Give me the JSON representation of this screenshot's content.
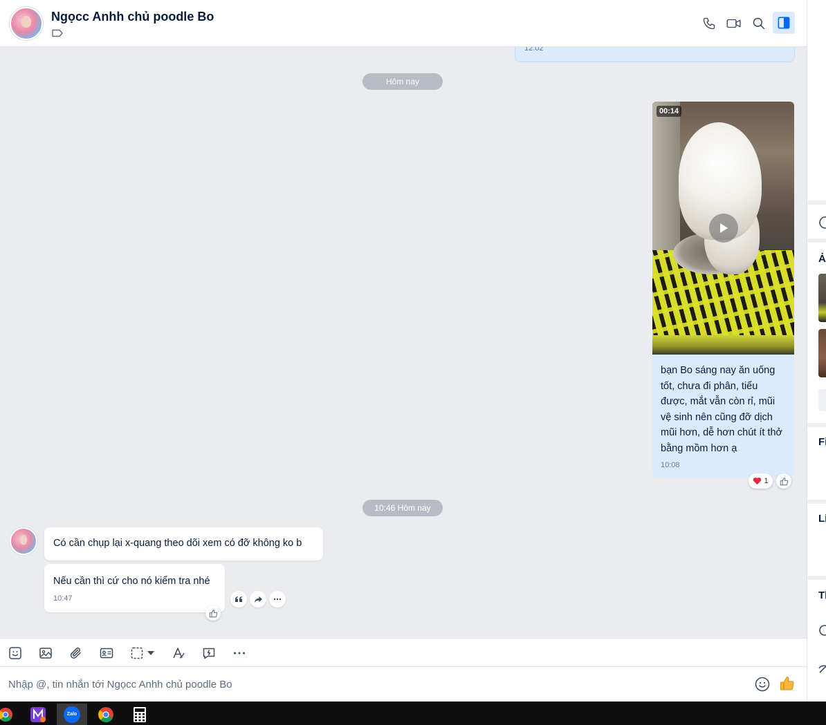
{
  "header": {
    "contact_name": "Ngọcc Anhh chủ poodle Bo",
    "icons": [
      "phone-icon",
      "video-call-icon",
      "search-icon",
      "sidebar-toggle-icon"
    ]
  },
  "chat": {
    "previous_time": "12:02",
    "date_separator_1": "Hôm nay",
    "video": {
      "duration": "00:14",
      "caption": "bạn Bo sáng nay ăn uống tốt, chưa đi phân, tiểu được, mắt vẫn còn rỉ, mũi vệ sinh nên cũng đỡ dịch mũi hơn, dễ hơn chút ít thở bằng mồm hơn ạ",
      "time": "10:08",
      "reaction_count": "1"
    },
    "date_separator_2": "10:46 Hôm nay",
    "incoming": [
      {
        "text": "Có cần chụp lại x-quang theo dõi xem có đỡ không ko b"
      },
      {
        "text": "Nếu cần thì cứ cho nó kiểm tra nhé",
        "time": "10:47"
      }
    ]
  },
  "right_panel": {
    "labels": [
      "Ả",
      "Fi",
      "Li",
      "Th"
    ]
  },
  "input": {
    "placeholder": "Nhập @, tin nhắn tới Ngọcc Anhh chủ poodle Bo",
    "value": ""
  },
  "taskbar": {
    "zalo_label": "Zalo",
    "apps": [
      "chrome-icon",
      "app-icon",
      "zalo-icon",
      "chrome-icon",
      "calculator-icon"
    ]
  },
  "colors": {
    "accent": "#0068ff",
    "outgoing_bubble": "#dbebfe",
    "chat_bg": "#ebecf0"
  }
}
